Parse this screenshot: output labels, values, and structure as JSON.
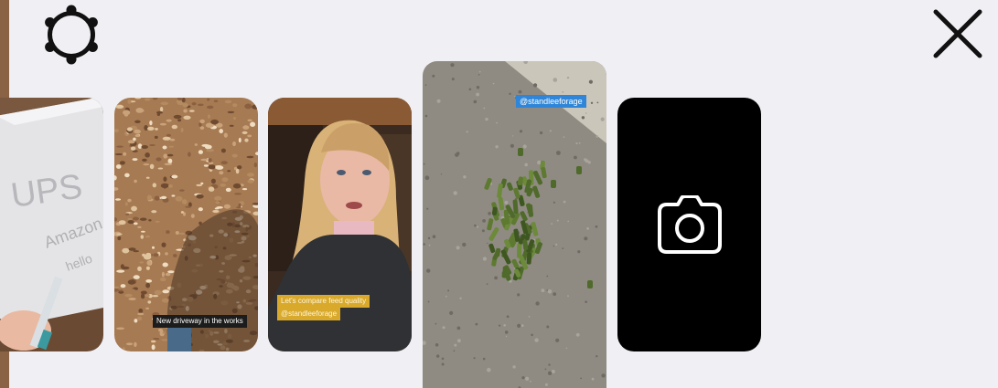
{
  "toolbar": {
    "settings_icon": "gear-icon",
    "close_icon": "close-icon"
  },
  "stories": [
    {
      "name": "story-thumbnail-ups-box",
      "caption": ""
    },
    {
      "name": "story-thumbnail-gravel-driveway",
      "caption": "New driveway in the works"
    },
    {
      "name": "story-thumbnail-selfie",
      "caption_line1": "Let's compare feed quality",
      "caption_line2": "@standleeforage"
    },
    {
      "name": "story-thumbnail-pellets",
      "caption": "@standleeforage",
      "selected": true
    }
  ],
  "camera_tile": {
    "icon": "camera-icon"
  },
  "colors": {
    "background": "#efeff4",
    "caption_blue": "#2f86d8",
    "caption_yellow": "#d9a92c"
  }
}
